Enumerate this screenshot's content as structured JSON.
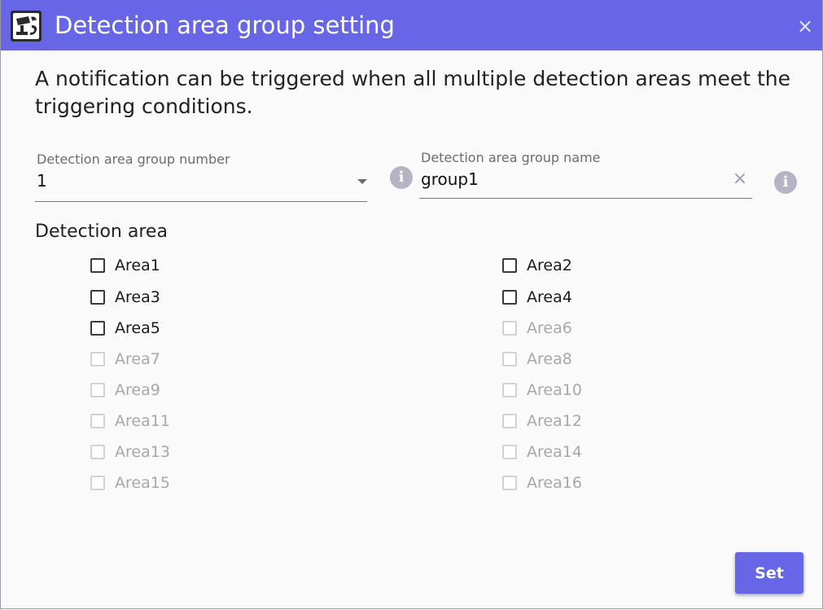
{
  "window": {
    "title": "Detection area group setting",
    "close_glyph": "×",
    "accent_color": "#6666e6",
    "app_icon": "camera-app-icon"
  },
  "description": "A notification can be triggered when all multiple detection areas meet the triggering conditions.",
  "group_number": {
    "label": "Detection area group number",
    "value": "1",
    "info_glyph": "i"
  },
  "group_name": {
    "label": "Detection area group name",
    "value": "group1",
    "clear_glyph": "×",
    "info_glyph": "i"
  },
  "detection_area": {
    "title": "Detection area",
    "items": [
      {
        "label": "Area1",
        "checked": false,
        "enabled": true
      },
      {
        "label": "Area2",
        "checked": false,
        "enabled": true
      },
      {
        "label": "Area3",
        "checked": false,
        "enabled": true
      },
      {
        "label": "Area4",
        "checked": false,
        "enabled": true
      },
      {
        "label": "Area5",
        "checked": false,
        "enabled": true
      },
      {
        "label": "Area6",
        "checked": false,
        "enabled": false
      },
      {
        "label": "Area7",
        "checked": false,
        "enabled": false
      },
      {
        "label": "Area8",
        "checked": false,
        "enabled": false
      },
      {
        "label": "Area9",
        "checked": false,
        "enabled": false
      },
      {
        "label": "Area10",
        "checked": false,
        "enabled": false
      },
      {
        "label": "Area11",
        "checked": false,
        "enabled": false
      },
      {
        "label": "Area12",
        "checked": false,
        "enabled": false
      },
      {
        "label": "Area13",
        "checked": false,
        "enabled": false
      },
      {
        "label": "Area14",
        "checked": false,
        "enabled": false
      },
      {
        "label": "Area15",
        "checked": false,
        "enabled": false
      },
      {
        "label": "Area16",
        "checked": false,
        "enabled": false
      }
    ]
  },
  "actions": {
    "set_label": "Set"
  }
}
